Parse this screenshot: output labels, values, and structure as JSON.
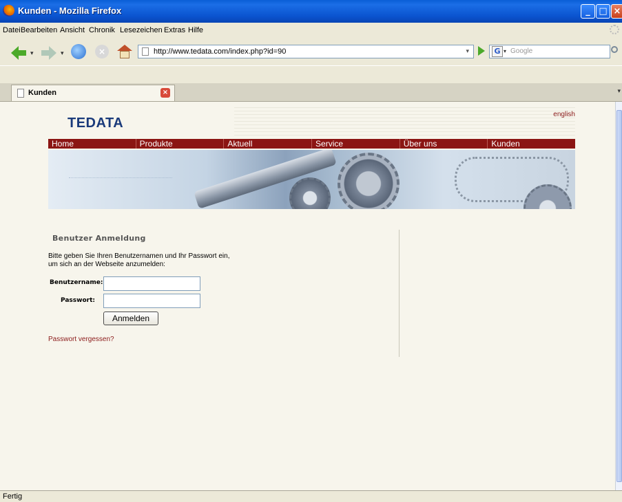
{
  "window": {
    "title": "Kunden - Mozilla Firefox"
  },
  "menu": {
    "items": [
      "Datei",
      "Bearbeiten",
      "Ansicht",
      "Chronik",
      "Lesezeichen",
      "Extras",
      "Hilfe"
    ]
  },
  "navigation": {
    "url": "http://www.tedata.com/index.php?id=90",
    "search_placeholder": "Google",
    "search_engine_letter": "G"
  },
  "tab": {
    "label": "Kunden"
  },
  "site": {
    "logo": "TEDATA",
    "language_link": "english",
    "nav": [
      "Home",
      "Produkte",
      "Aktuell",
      "Service",
      "Über uns",
      "Kunden"
    ],
    "nav_color": "#8b1513"
  },
  "login": {
    "heading": "Benutzer Anmeldung",
    "instruction_line1": "Bitte geben Sie Ihren Benutzernamen und Ihr Passwort ein,",
    "instruction_line2": "um sich an der Webseite anzumelden:",
    "username_label": "Benutzername:",
    "username_value": "",
    "password_label": "Passwort:",
    "password_value": "",
    "submit_label": "Anmelden",
    "forgot_link": "Passwort vergessen?"
  },
  "status": {
    "text": "Fertig"
  },
  "colors": {
    "titlebar": "#0b54d0",
    "link": "#8b1a1a",
    "logo": "#1a3a7a"
  }
}
